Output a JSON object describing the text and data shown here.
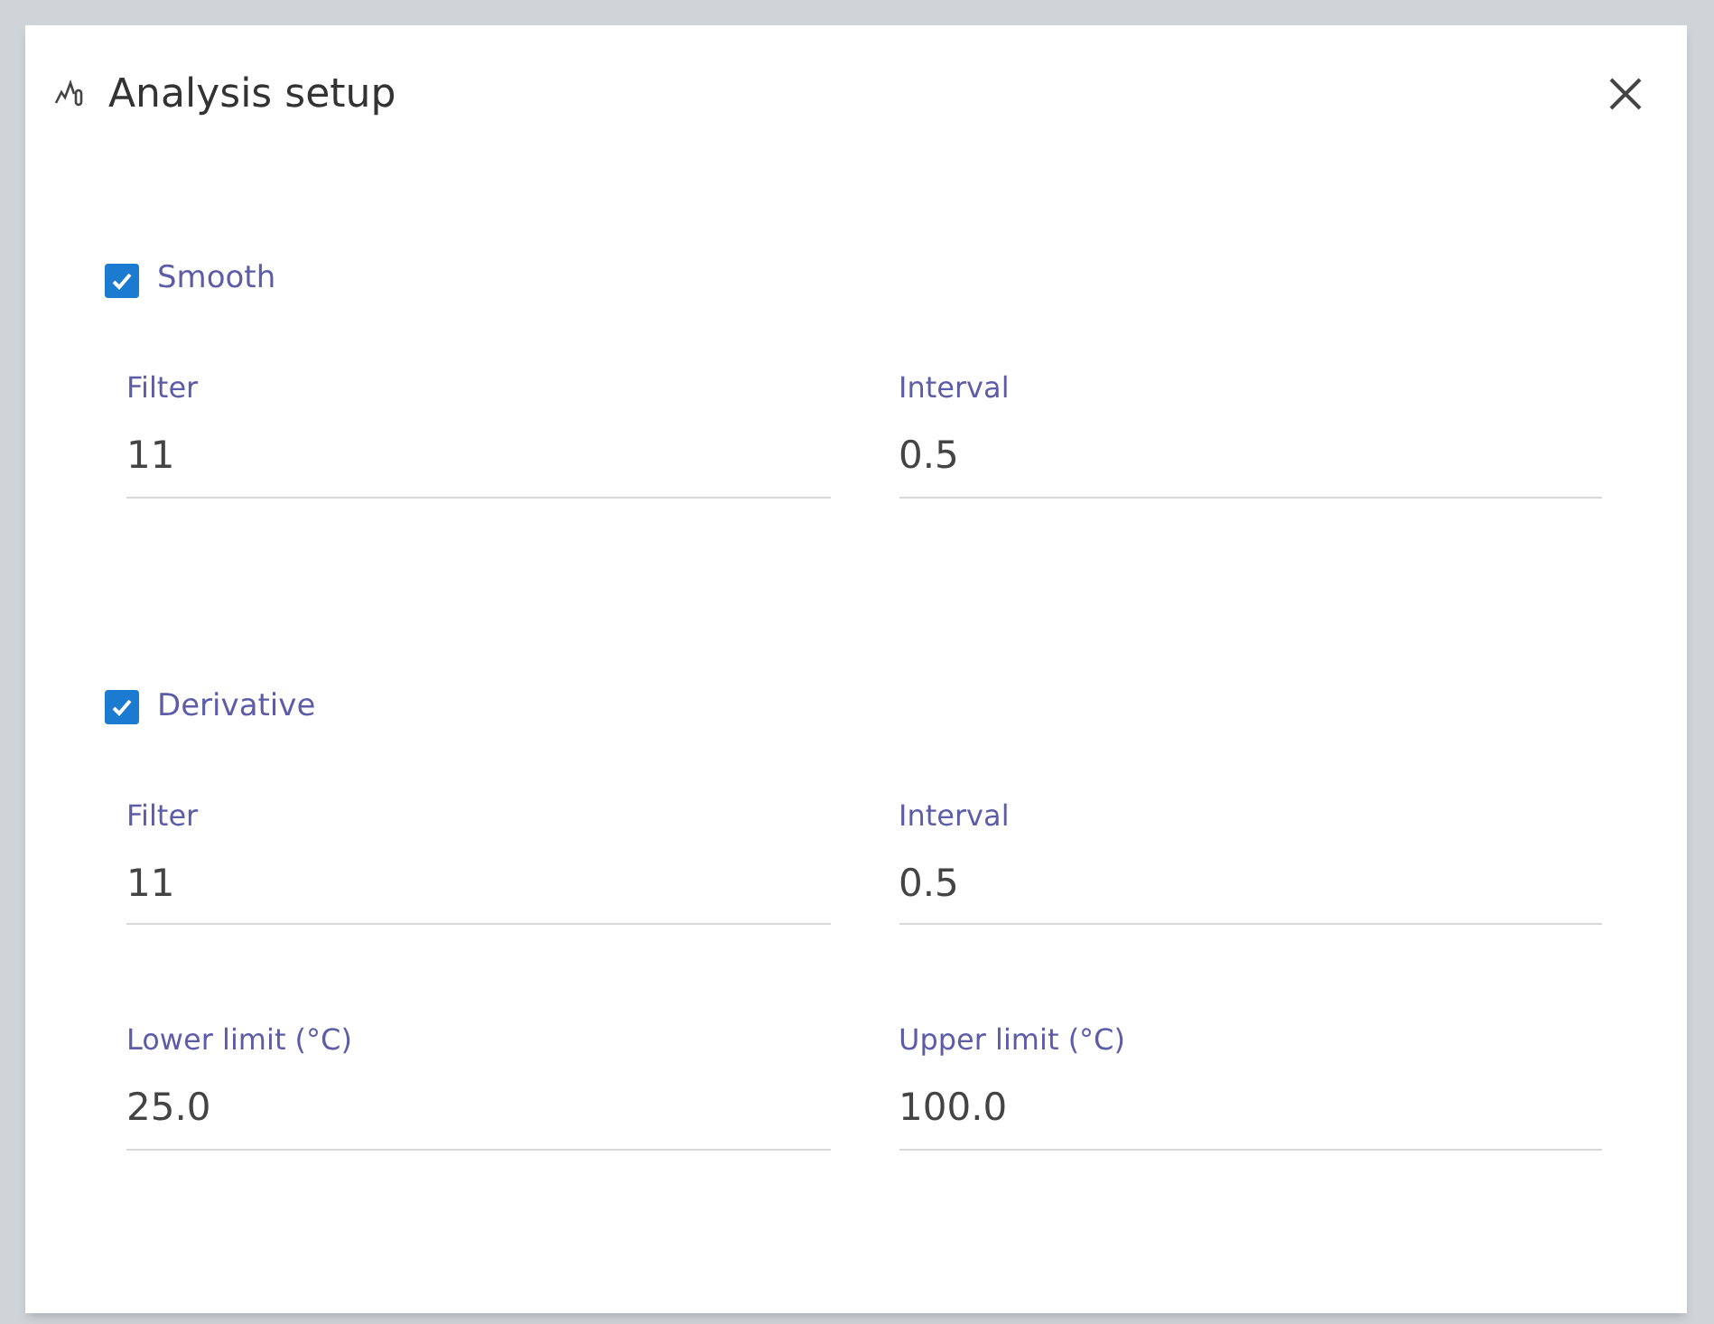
{
  "dialog": {
    "title": "Analysis setup"
  },
  "sections": [
    {
      "label": "Smooth",
      "checked": true,
      "fields": [
        {
          "label": "Filter",
          "value": "11"
        },
        {
          "label": "Interval",
          "value": "0.5"
        }
      ]
    },
    {
      "label": "Derivative",
      "checked": true,
      "fields": [
        {
          "label": "Filter",
          "value": "11"
        },
        {
          "label": "Interval",
          "value": "0.5"
        },
        {
          "label": "Lower limit (°C)",
          "value": "25.0"
        },
        {
          "label": "Upper limit (°C)",
          "value": "100.0"
        }
      ]
    }
  ]
}
